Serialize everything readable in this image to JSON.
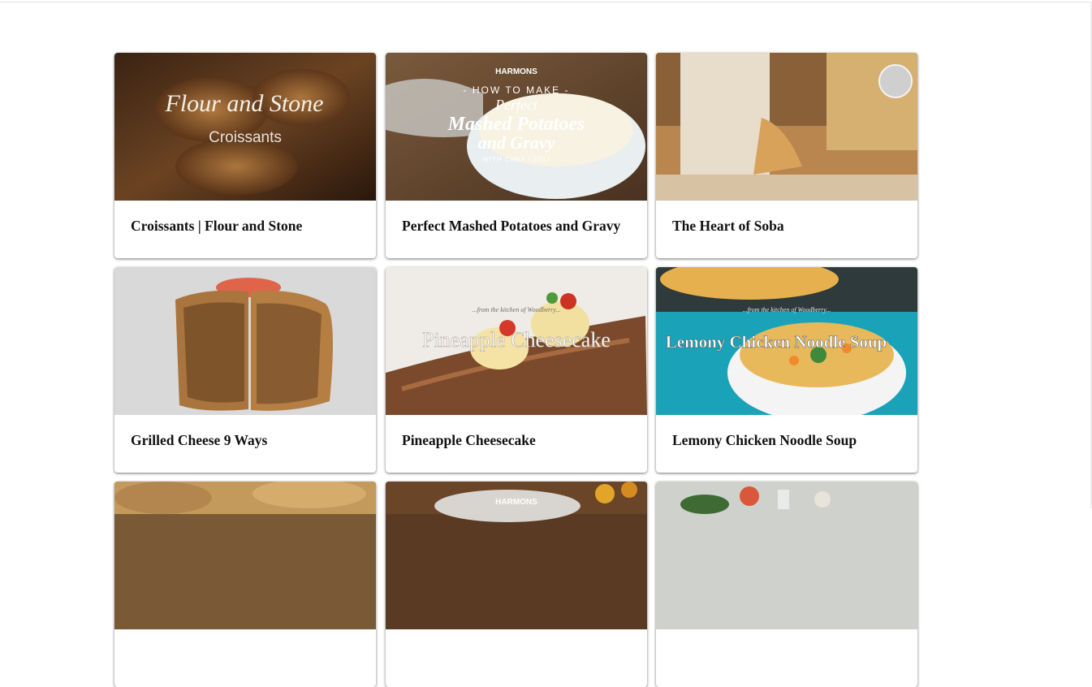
{
  "cards": [
    {
      "title": "Croissants | Flour and Stone",
      "image_icon": "croissants-image",
      "overlay": [
        "Flour and Stone",
        "Croissants"
      ]
    },
    {
      "title": "Perfect Mashed Potatoes and Gravy",
      "image_icon": "mashed-potatoes-image",
      "overlay": [
        "HARMONS",
        "- HOW TO MAKE -",
        "Perfect",
        "Mashed Potatoes",
        "and Gravy",
        "WITH CHEF LESLI"
      ]
    },
    {
      "title": "The Heart of Soba",
      "image_icon": "soba-image",
      "overlay": []
    },
    {
      "title": "Grilled Cheese 9 Ways",
      "image_icon": "grilled-cheese-image",
      "overlay": []
    },
    {
      "title": "Pineapple Cheesecake",
      "image_icon": "pineapple-cheesecake-image",
      "overlay": [
        "...from the kitchen of Woodberry...",
        "Pineapple Cheesecake"
      ]
    },
    {
      "title": "Lemony Chicken Noodle Soup",
      "image_icon": "chicken-noodle-soup-image",
      "overlay": [
        "...from the kitchen of Woodberry...",
        "Lemony Chicken Noodle Soup"
      ]
    },
    {
      "title": "",
      "image_icon": "bread-image",
      "overlay": []
    },
    {
      "title": "",
      "image_icon": "harmons-dish-image",
      "overlay": [
        "HARMONS"
      ]
    },
    {
      "title": "",
      "image_icon": "vegetables-image",
      "overlay": []
    }
  ],
  "colors": {
    "card_background": "#ffffff",
    "title_text": "#111111",
    "page_background": "#ffffff"
  }
}
